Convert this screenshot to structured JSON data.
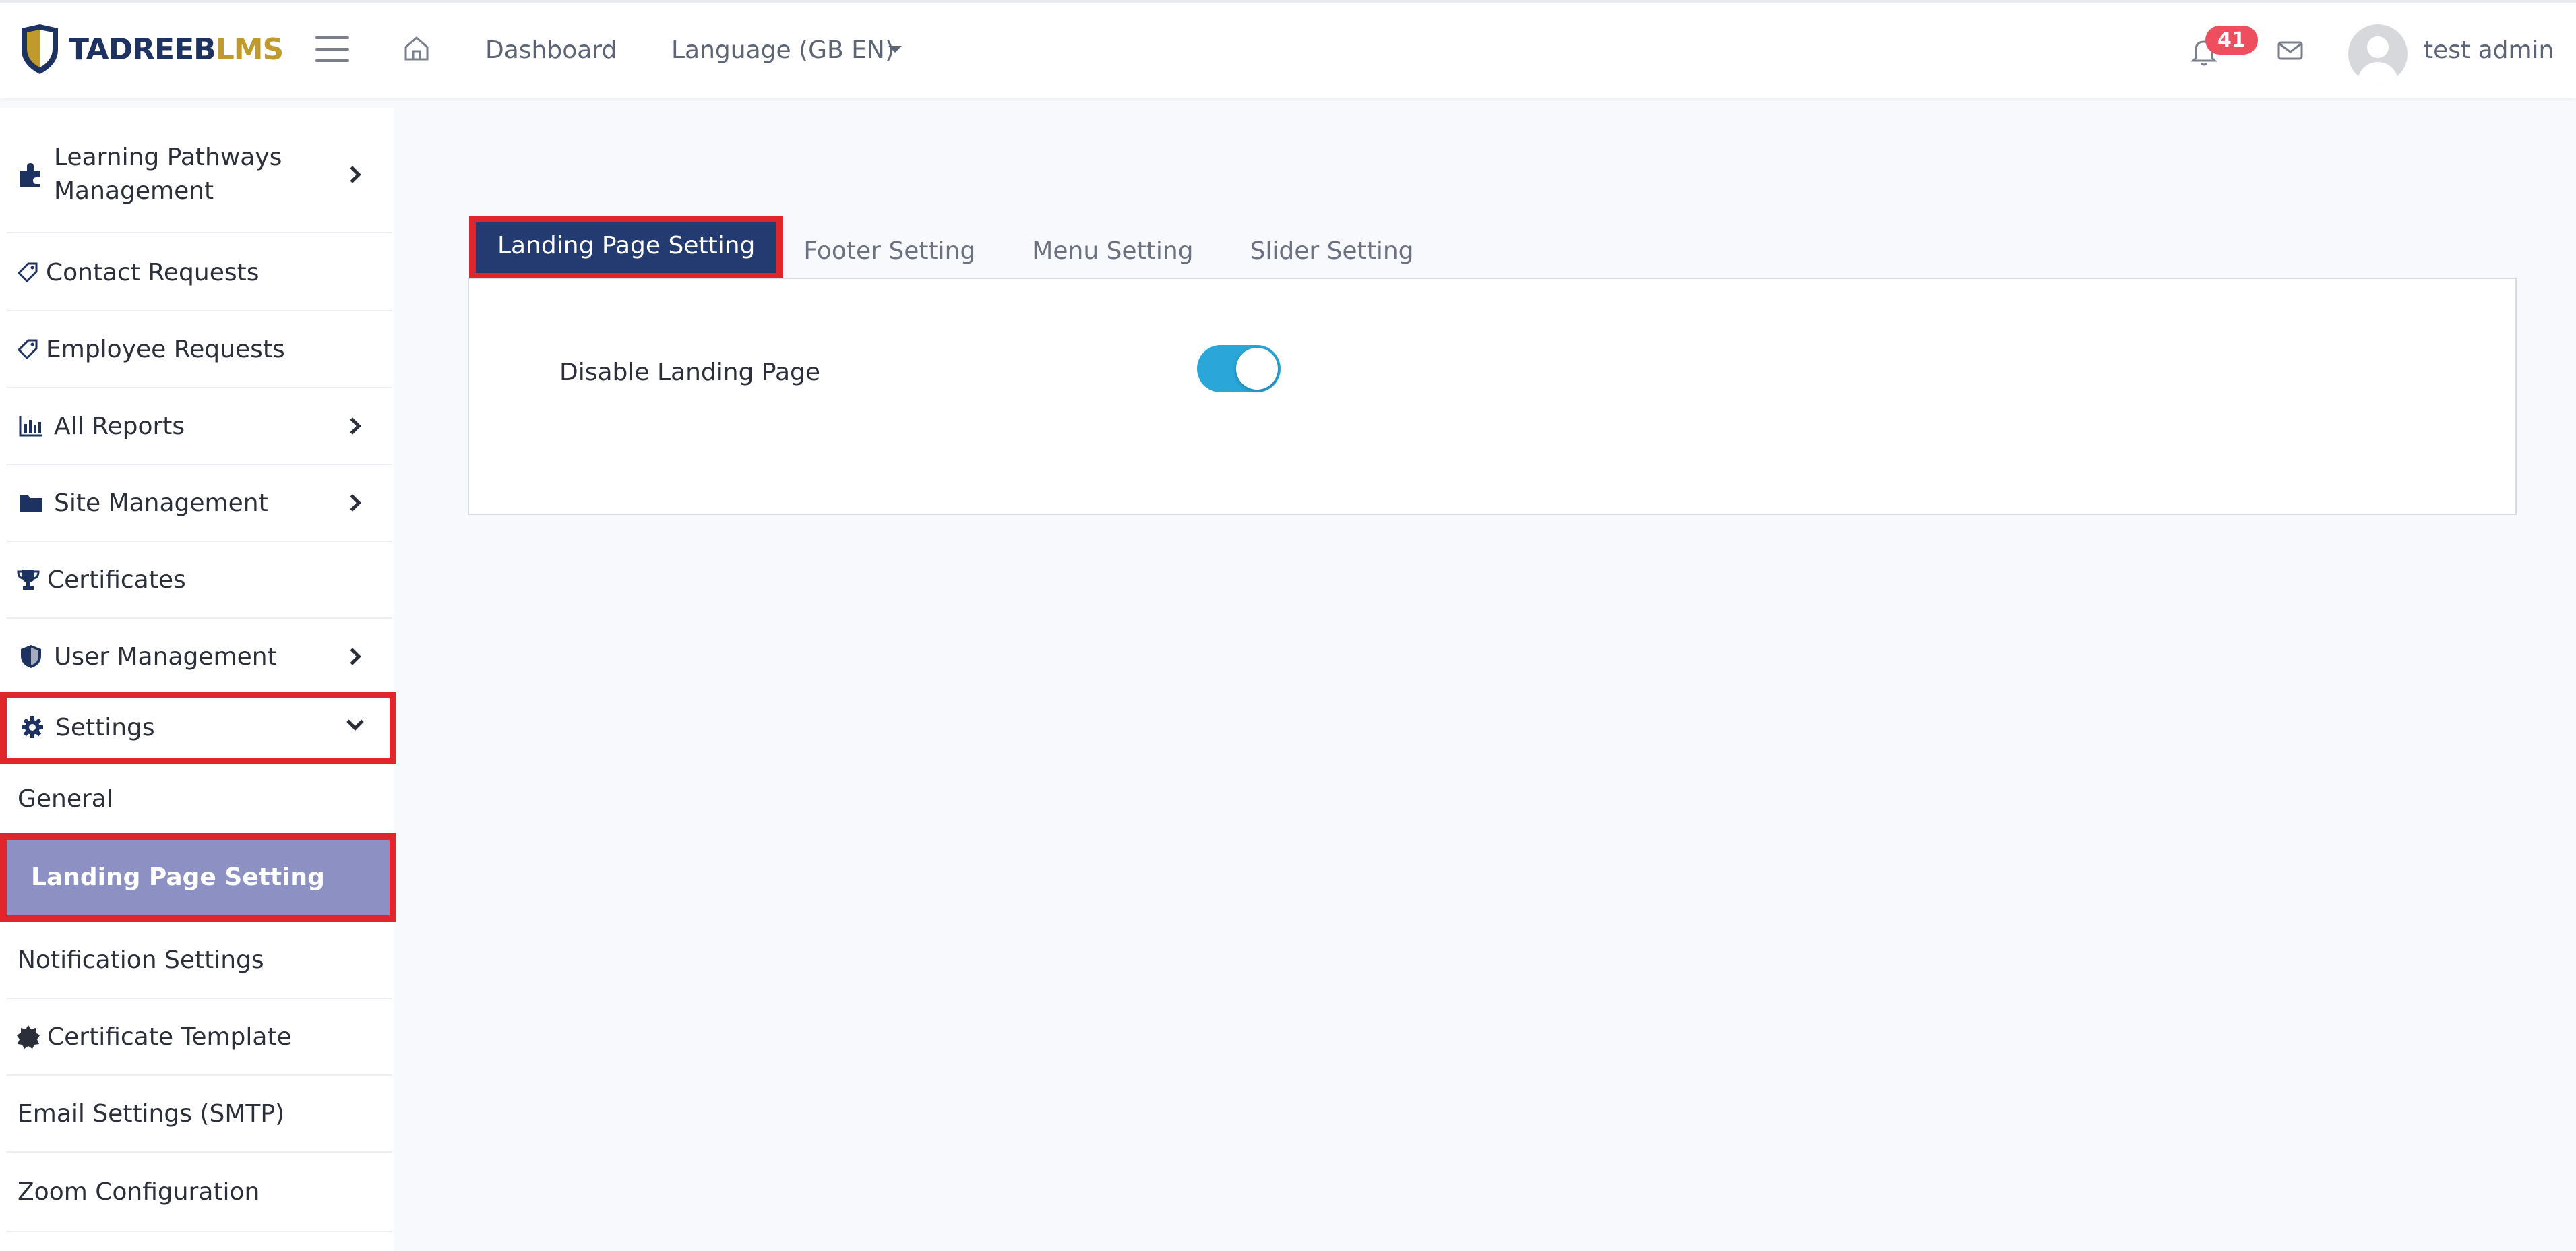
{
  "brand": {
    "part1": "TADREEB",
    "part2": "LMS",
    "color_primary": "#1d3260",
    "color_accent": "#c19a2d"
  },
  "topbar": {
    "menu_icon": "hamburger-icon",
    "home_icon": "home-icon",
    "dashboard_label": "Dashboard",
    "language_label": "Language (GB EN)",
    "notification_count": "41",
    "user_name": "test admin"
  },
  "sidebar": {
    "items": [
      {
        "label": "Learning Pathways Management",
        "icon": "puzzle-icon",
        "has_children": true
      },
      {
        "label": "Contact Requests",
        "icon": "tag-icon"
      },
      {
        "label": "Employee Requests",
        "icon": "tag-icon"
      },
      {
        "label": "All Reports",
        "icon": "bar-chart-icon",
        "has_children": true
      },
      {
        "label": "Site Management",
        "icon": "folder-icon",
        "has_children": true
      },
      {
        "label": "Certificates",
        "icon": "trophy-icon"
      },
      {
        "label": "User Management",
        "icon": "shield-icon",
        "has_children": true
      },
      {
        "label": "Settings",
        "icon": "gear-icon",
        "expanded": true
      }
    ],
    "settings_children": [
      {
        "label": "General"
      },
      {
        "label": "Landing Page Setting",
        "active": true
      },
      {
        "label": "Notification Settings"
      },
      {
        "label": "Certificate Template",
        "icon": "badge-icon"
      },
      {
        "label": "Email Settings (SMTP)"
      },
      {
        "label": "Zoom Configuration"
      }
    ]
  },
  "tabs": [
    {
      "label": "Landing Page Setting",
      "active": true
    },
    {
      "label": "Footer Setting"
    },
    {
      "label": "Menu Setting"
    },
    {
      "label": "Slider Setting"
    }
  ],
  "panel": {
    "setting_label": "Disable Landing Page",
    "toggle_on": true,
    "toggle_color": "#2aa6d9"
  }
}
